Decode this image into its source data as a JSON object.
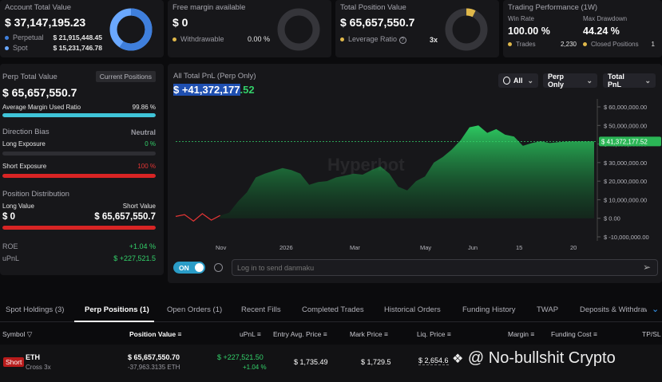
{
  "account": {
    "title": "Account Total Value",
    "value": "$ 37,147,195.23",
    "perpetual_label": "Perpetual",
    "perpetual_value": "$ 21,915,448.45",
    "spot_label": "Spot",
    "spot_value": "$ 15,231,746.78",
    "perpetual_color": "#3f7fdc",
    "spot_color": "#6aa8ff"
  },
  "margin": {
    "title": "Free margin available",
    "value": "$ 0",
    "withdrawable_label": "Withdrawable",
    "withdrawable_value": "0.00 %"
  },
  "position": {
    "title": "Total Position Value",
    "value": "$ 65,657,550.7",
    "leverage_label": "Leverage Ratio",
    "leverage_value": "3x"
  },
  "performance": {
    "title": "Trading Performance (1W)",
    "win_rate_label": "Win Rate",
    "win_rate_value": "100.00 %",
    "drawdown_label": "Max Drawdown",
    "drawdown_value": "44.24 %",
    "trades_label": "Trades",
    "trades_value": "2,230",
    "closed_label": "Closed Positions",
    "closed_value": "1"
  },
  "perp": {
    "title": "Perp Total Value",
    "current_positions_label": "Current Positions",
    "value": "$ 65,657,550.7",
    "avg_margin_label": "Average Margin Used Ratio",
    "avg_margin_value": "99.86 %",
    "avg_margin_ratio": 0.9986,
    "direction_label": "Direction Bias",
    "direction_value": "Neutral",
    "long_exposure_label": "Long Exposure",
    "long_exposure_value": "0 %",
    "long_exposure_ratio": 0,
    "short_exposure_label": "Short Exposure",
    "short_exposure_value": "100 %",
    "short_exposure_ratio": 1.0,
    "distribution_label": "Position Distribution",
    "long_value_label": "Long Value",
    "short_value_label": "Short Value",
    "long_value": "$ 0",
    "short_value": "$ 65,657,550.7",
    "distribution_short_ratio": 1.0,
    "roe_label": "ROE",
    "roe_value": "+1.04 %",
    "upnl_label": "uPnL",
    "upnl_value": "$ +227,521.5"
  },
  "chart_panel": {
    "title": "All Total PnL (Perp Only)",
    "pnl_value_selected": "$ +41,372,177",
    "pnl_value_rest": ".52",
    "filter_all": "All",
    "filter_perp": "Perp Only",
    "filter_total": "Total PnL",
    "watermark": "Hyperbot",
    "current_label": "$ 41,372,177.52",
    "toggle_label": "ON",
    "danmaku_placeholder": "Log in to send danmaku"
  },
  "chart_data": {
    "type": "area",
    "title": "All Total PnL (Perp Only)",
    "x_tick_labels": [
      "Nov",
      "2026",
      "Mar",
      "May",
      "Jun",
      "15",
      "20"
    ],
    "y_tick_labels": [
      "$ 60,000,000.00",
      "$ 50,000,000.00",
      "$ 40,000,000.00",
      "$ 30,000,000.00",
      "$ 20,000,000.00",
      "$ 10,000,000.00",
      "$ 0.00",
      "$ -10,000,000.00"
    ],
    "ylim": [
      -10000000,
      60000000
    ],
    "current_value": 41372177.52,
    "x": [
      0,
      1,
      2,
      3,
      4,
      5,
      6,
      7,
      8,
      9,
      10,
      11,
      12,
      13,
      14,
      15,
      16,
      17,
      18,
      19,
      20,
      21,
      22,
      23,
      24,
      25,
      26,
      27,
      28,
      29,
      30,
      31,
      32,
      33,
      34,
      35,
      36,
      37,
      38,
      39,
      40,
      41,
      42,
      43,
      44,
      45,
      46,
      47
    ],
    "values": [
      1000000,
      2000000,
      -1500000,
      2500000,
      -1000000,
      1500000,
      3000000,
      9000000,
      14000000,
      22000000,
      24000000,
      25500000,
      27000000,
      26000000,
      24000000,
      18000000,
      19500000,
      20000000,
      22000000,
      23000000,
      24000000,
      23500000,
      26000000,
      28000000,
      24000000,
      17000000,
      15000000,
      20000000,
      22500000,
      30000000,
      33000000,
      37000000,
      42000000,
      49000000,
      50000000,
      46000000,
      48000000,
      45000000,
      44000000,
      39000000,
      40500000,
      41500000,
      40500000,
      41000000,
      41300000,
      41372177,
      41372177,
      41372177
    ],
    "grid": false
  },
  "tabs": [
    {
      "label": "Spot Holdings (3)"
    },
    {
      "label": "Perp Positions (1)"
    },
    {
      "label": "Open Orders (1)"
    },
    {
      "label": "Recent Fills"
    },
    {
      "label": "Completed Trades"
    },
    {
      "label": "Historical Orders"
    },
    {
      "label": "Funding History"
    },
    {
      "label": "TWAP"
    },
    {
      "label": "Deposits & Withdraw"
    }
  ],
  "table": {
    "headers": {
      "symbol": "Symbol",
      "position_value": "Position Value",
      "upnl": "uPnL",
      "entry": "Entry Avg. Price",
      "mark": "Mark Price",
      "liq": "Liq. Price",
      "margin": "Margin",
      "funding": "Funding Cost",
      "tpsl": "TP/SL"
    },
    "row": {
      "side": "Short",
      "symbol": "ETH",
      "mode": "Cross 3x",
      "position_value": "$ 65,657,550.70",
      "position_size": "-37,963.3135 ETH",
      "upnl": "$ +227,521.50",
      "roe": "+1.04 %",
      "entry": "$ 1,735.49",
      "mark": "$ 1,729.5",
      "liq": "$ 2,654.6"
    }
  },
  "overlay": {
    "watermark_text": "@ No-bullshit Crypto"
  }
}
